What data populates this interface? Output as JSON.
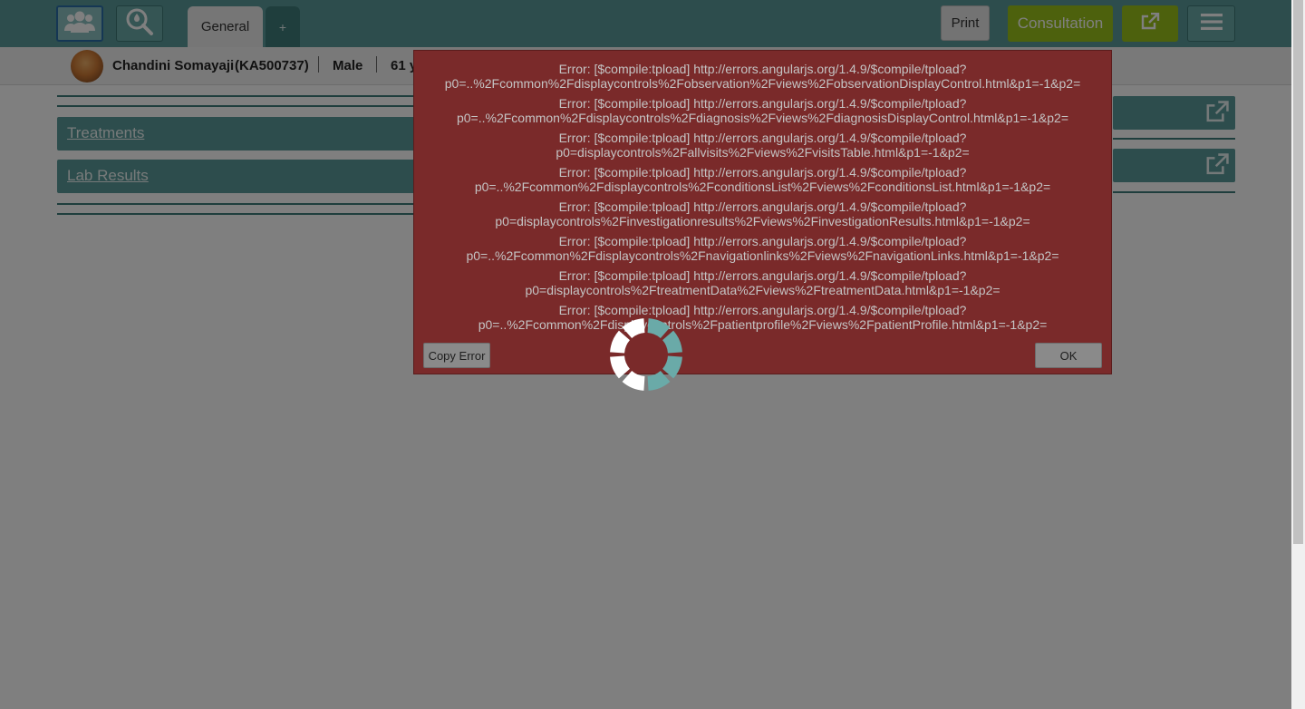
{
  "header": {
    "tabs": [
      {
        "label": "General"
      },
      {
        "label": "+"
      }
    ],
    "print_label": "Print",
    "consultation_label": "Consultation",
    "icons": {
      "patients": "users-icon",
      "search": "search-patient-icon",
      "external": "external-link-icon",
      "menu": "hamburger-menu-icon"
    }
  },
  "patient": {
    "name": "Chandini Somayaji",
    "id": "(KA500737)",
    "gender": "Male",
    "age": "61 y"
  },
  "sections": {
    "treatments": "Treatments",
    "lab_results": "Lab Results"
  },
  "error_dialog": {
    "errors": [
      {
        "line1": "Error: [$compile:tpload] http://errors.angularjs.org/1.4.9/$compile/tpload?",
        "line2": "p0=..%2Fcommon%2Fdisplaycontrols%2Fobservation%2Fviews%2FobservationDisplayControl.html&p1=-1&p2="
      },
      {
        "line1": "Error: [$compile:tpload] http://errors.angularjs.org/1.4.9/$compile/tpload?",
        "line2": "p0=..%2Fcommon%2Fdisplaycontrols%2Fdiagnosis%2Fviews%2FdiagnosisDisplayControl.html&p1=-1&p2="
      },
      {
        "line1": "Error: [$compile:tpload] http://errors.angularjs.org/1.4.9/$compile/tpload?",
        "line2": "p0=displaycontrols%2Fallvisits%2Fviews%2FvisitsTable.html&p1=-1&p2="
      },
      {
        "line1": "Error: [$compile:tpload] http://errors.angularjs.org/1.4.9/$compile/tpload?",
        "line2": "p0=..%2Fcommon%2Fdisplaycontrols%2FconditionsList%2Fviews%2FconditionsList.html&p1=-1&p2="
      },
      {
        "line1": "Error: [$compile:tpload] http://errors.angularjs.org/1.4.9/$compile/tpload?",
        "line2": "p0=displaycontrols%2Finvestigationresults%2Fviews%2FinvestigationResults.html&p1=-1&p2="
      },
      {
        "line1": "Error: [$compile:tpload] http://errors.angularjs.org/1.4.9/$compile/tpload?",
        "line2": "p0=..%2Fcommon%2Fdisplaycontrols%2Fnavigationlinks%2Fviews%2FnavigationLinks.html&p1=-1&p2="
      },
      {
        "line1": "Error: [$compile:tpload] http://errors.angularjs.org/1.4.9/$compile/tpload?",
        "line2": "p0=displaycontrols%2FtreatmentData%2Fviews%2FtreatmentData.html&p1=-1&p2="
      },
      {
        "line1": "Error: [$compile:tpload] http://errors.angularjs.org/1.4.9/$compile/tpload?",
        "line2": "p0=..%2Fcommon%2Fdisplaycontrols%2Fpatientprofile%2Fviews%2FpatientProfile.html&p1=-1&p2="
      }
    ],
    "copy_label": "Copy Error",
    "ok_label": "OK"
  },
  "colors": {
    "header": "#5b9b9a",
    "accent_green": "#9ac31a",
    "error_bg": "#7a2a2a"
  }
}
